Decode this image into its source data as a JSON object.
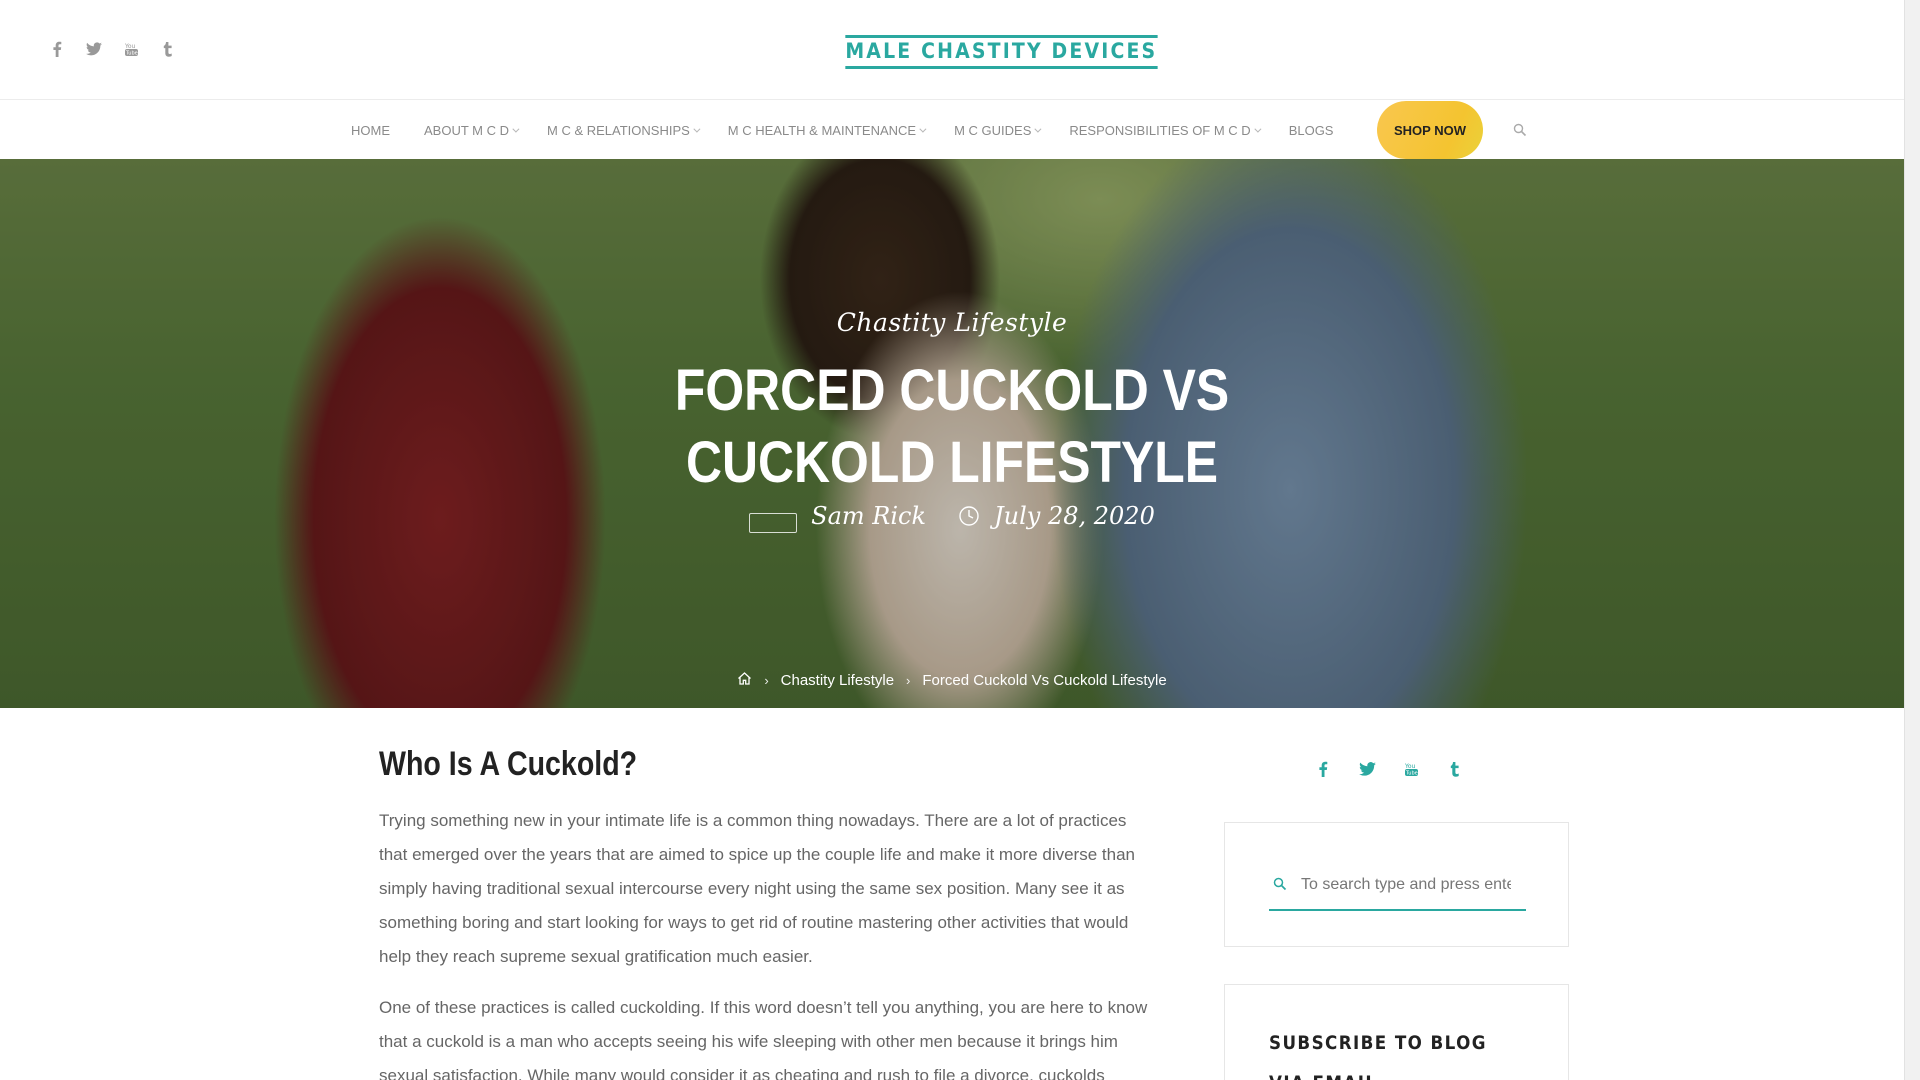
{
  "site": {
    "logo": "MALE CHASTITY DEVICES",
    "brand_color": "#2aa8a0",
    "accent_color": "#f4c430"
  },
  "top_social": [
    {
      "icon": "facebook-icon"
    },
    {
      "icon": "twitter-icon"
    },
    {
      "icon": "youtube-icon"
    },
    {
      "icon": "tumblr-icon"
    }
  ],
  "nav": {
    "items": [
      {
        "label": "HOME",
        "dropdown": false
      },
      {
        "label": "ABOUT M C D",
        "dropdown": true
      },
      {
        "label": "M C & RELATIONSHIPS",
        "dropdown": true
      },
      {
        "label": "M C HEALTH & MAINTENANCE",
        "dropdown": true
      },
      {
        "label": "M C GUIDES",
        "dropdown": true
      },
      {
        "label": "RESPONSIBILITIES OF M C D",
        "dropdown": true
      },
      {
        "label": "BLOGS",
        "dropdown": false
      }
    ],
    "shop_label": "SHOP NOW"
  },
  "hero": {
    "category": "Chastity Lifestyle",
    "title": "FORCED CUCKOLD VS CUCKOLD LIFESTYLE",
    "author": "Sam Rick",
    "date": "July 28, 2020",
    "breadcrumb": {
      "category": "Chastity Lifestyle",
      "current": "Forced Cuckold Vs Cuckold Lifestyle"
    }
  },
  "article": {
    "heading": "Who Is A Cuckold?",
    "paragraphs": [
      "Trying something new in your intimate life is a common thing nowadays. There are a lot of practices that emerged over the years that are aimed to spice up the couple life and make it more diverse than simply having traditional sexual intercourse every night using the same sex position. Many see it as something boring and start looking for ways to get rid of routine mastering other activities that would help they reach supreme sexual gratification much easier.",
      "One of these practices is called cuckolding. If this word doesn’t tell you anything, you are here to know that a cuckold is a man who accepts seeing his wife sleeping with other men because it brings him sexual satisfaction. While many would consider it as cheating and rush to file a divorce, cuckolds"
    ]
  },
  "sidebar": {
    "social": [
      {
        "icon": "facebook-icon"
      },
      {
        "icon": "twitter-icon"
      },
      {
        "icon": "youtube-icon"
      },
      {
        "icon": "tumblr-icon"
      }
    ],
    "search_placeholder": "To search type and press enter",
    "subscribe_title": "SUBSCRIBE TO BLOG VIA EMAIL"
  }
}
